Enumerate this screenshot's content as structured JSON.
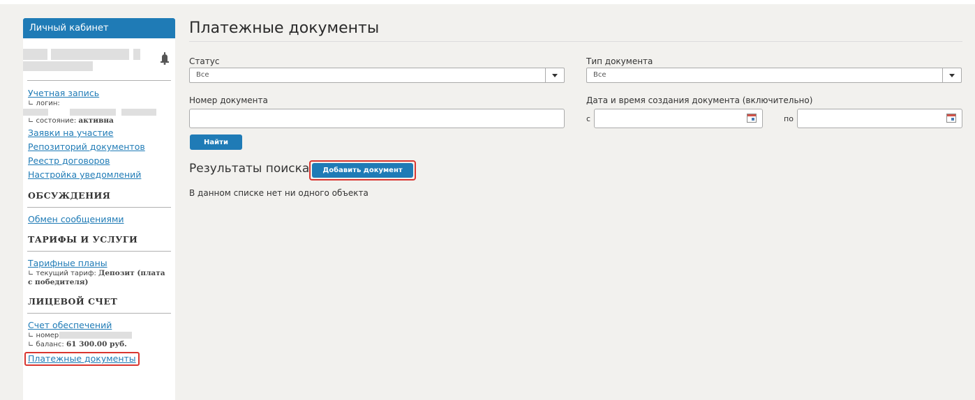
{
  "sidebar": {
    "header": "Личный кабинет",
    "account_link": "Учетная запись",
    "login_label": "∟ логин:",
    "state_label": "∟ состояние:",
    "state_value": "активна",
    "links": [
      "Заявки на участие",
      "Репозиторий документов",
      "Реестр договоров",
      "Настройка уведомлений"
    ],
    "discussions_title": "ОБСУЖДЕНИЯ",
    "messages_link": "Обмен сообщениями",
    "tariffs_title": "ТАРИФЫ И УСЛУГИ",
    "tariff_plans_link": "Тарифные планы",
    "current_tariff_label": "∟ текущий тариф:",
    "current_tariff_value": "Депозит (плата с победителя)",
    "account_title": "ЛИЦЕВОЙ СЧЕТ",
    "deposit_link": "Счет обеспечений",
    "number_label": "∟ номер:",
    "balance_label": "∟ баланс:",
    "balance_value": "61 300.00 руб.",
    "payment_docs_link": "Платежные документы"
  },
  "main": {
    "title": "Платежные документы",
    "status_label": "Статус",
    "status_value": "Все",
    "doc_type_label": "Тип документа",
    "doc_type_value": "Все",
    "doc_number_label": "Номер документа",
    "date_label": "Дата и время создания документа (включительно)",
    "from_label": "с",
    "to_label": "по",
    "search_button": "Найти",
    "results_title": "Результаты поиска",
    "add_button": "Добавить документ",
    "empty_text": "В данном списке нет ни одного объекта"
  },
  "colors": {
    "accent": "#1f7bb6",
    "highlight": "#d9352f",
    "background": "#f2f1ee"
  }
}
